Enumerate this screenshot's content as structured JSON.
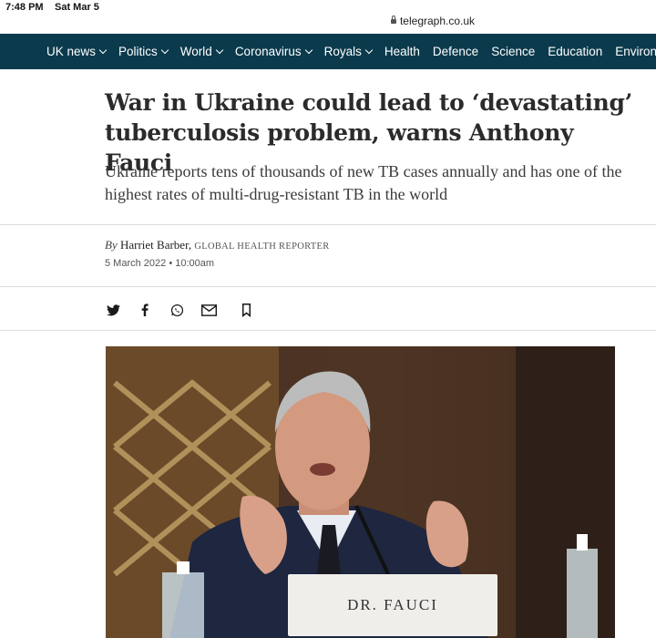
{
  "status_bar": {
    "time": "7:48 PM",
    "date": "Sat Mar 5"
  },
  "browser": {
    "url": "telegraph.co.uk"
  },
  "nav": {
    "items": [
      {
        "label": "UK news",
        "has_dropdown": true
      },
      {
        "label": "Politics",
        "has_dropdown": true
      },
      {
        "label": "World",
        "has_dropdown": true
      },
      {
        "label": "Coronavirus",
        "has_dropdown": true
      },
      {
        "label": "Royals",
        "has_dropdown": true
      },
      {
        "label": "Health",
        "has_dropdown": false
      },
      {
        "label": "Defence",
        "has_dropdown": false
      },
      {
        "label": "Science",
        "has_dropdown": false
      },
      {
        "label": "Education",
        "has_dropdown": false
      },
      {
        "label": "Environment",
        "has_dropdown": false
      }
    ],
    "background": "#0b3a4d"
  },
  "article": {
    "headline": "War in Ukraine could lead to ‘devastating’ tuberculosis problem, warns Anthony Fauci",
    "standfirst": "Ukraine reports tens of thousands of new TB cases annually and has one of the highest rates of multi-drug-resistant TB in the world",
    "byline": {
      "prefix": "By",
      "author": "Harriet Barber,",
      "role": "GLOBAL HEALTH REPORTER"
    },
    "dateline": "5 March 2022 • 10:00am",
    "share_icons": [
      "twitter-icon",
      "facebook-icon",
      "whatsapp-icon",
      "email-icon",
      "bookmark-icon"
    ],
    "photo": {
      "nameplate": "DR. FAUCI"
    }
  }
}
